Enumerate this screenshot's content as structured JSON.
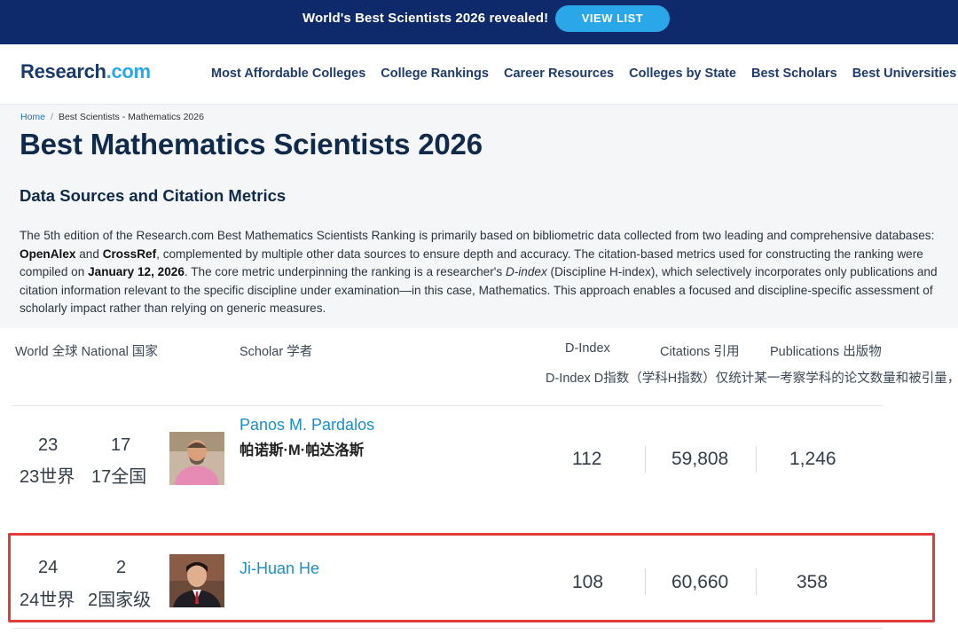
{
  "banner": {
    "text": "World's Best Scientists 2026 revealed!",
    "button_label": "VIEW LIST"
  },
  "logo": {
    "main": "Research",
    "dot": ".com"
  },
  "nav": {
    "links": [
      "Most Affordable Colleges",
      "College Rankings",
      "Career Resources",
      "Colleges by State",
      "Best Scholars",
      "Best Universities"
    ]
  },
  "breadcrumb": {
    "home": "Home",
    "sep": "/",
    "current": "Best Scientists - Mathematics 2026"
  },
  "page_title": "Best Mathematics Scientists 2026",
  "section_title": "Data Sources and Citation Metrics",
  "paragraph": {
    "p1": "The 5th edition of the Research.com Best Mathematics Scientists Ranking is primarily based on bibliometric data collected from two leading and comprehensive databases: ",
    "openalex": "OpenAlex",
    "and": " and ",
    "crossref": "CrossRef",
    "p2": ", complemented by multiple other data sources to ensure depth and accuracy. The citation-based metrics used for constructing the ranking were compiled on ",
    "date": "January 12, 2026",
    "p3": ". The core metric underpinning the ranking is a researcher's ",
    "dindex": "D-index",
    "p4": " (Discipline H-index), which selectively incorporates only publications and citation information relevant to the specific discipline under examination—in this case, Mathematics. This approach enables a focused and discipline-specific assessment of scholarly impact rather than relying on generic measures."
  },
  "table": {
    "headers": {
      "rank": "World 全球 National 国家",
      "scholar": "Scholar 学者",
      "dindex": "D-Index",
      "citations": "Citations 引用",
      "publications": "Publications 出版物"
    },
    "dindex_note": "D-Index D指数（学科H指数）仅统计某一考察学科的论文数量和被引量，",
    "rows": [
      {
        "world": "23",
        "national": "17",
        "world_cn": "23世界",
        "national_cn": "17全国",
        "name": "Panos M. Pardalos",
        "name_cn": "帕诺斯·M·帕达洛斯",
        "dindex": "112",
        "citations": "59,808",
        "publications": "1,246"
      },
      {
        "world": "24",
        "national": "2",
        "world_cn": "24世界",
        "national_cn": "2国家级",
        "name": "Ji-Huan He",
        "name_cn": "",
        "dindex": "108",
        "citations": "60,660",
        "publications": "358"
      }
    ]
  },
  "colors": {
    "banner_bg": "#0f2a6b",
    "button_bg": "#2aa7e8",
    "link": "#1a8fc9",
    "highlight_border": "#e23b3b"
  }
}
